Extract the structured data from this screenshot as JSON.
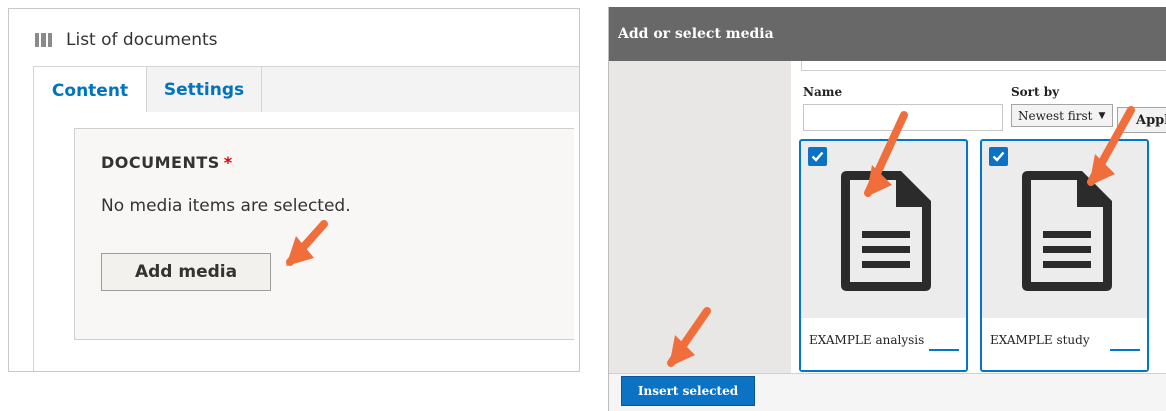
{
  "left_panel": {
    "title": "List of documents",
    "tabs": [
      {
        "label": "Content",
        "active": true
      },
      {
        "label": "Settings",
        "active": false
      }
    ],
    "field": {
      "label": "DOCUMENTS",
      "required_mark": "*",
      "empty_message": "No media items are selected.",
      "add_button": "Add media"
    }
  },
  "media_dialog": {
    "title": "Add or select media",
    "filters": {
      "name_label": "Name",
      "name_value": "",
      "sort_label": "Sort by",
      "sort_selected": "Newest first",
      "apply_label": "Appl"
    },
    "items": [
      {
        "name": "EXAMPLE analysis",
        "checked": true,
        "icon": "document-icon"
      },
      {
        "name": "EXAMPLE study",
        "checked": true,
        "icon": "document-icon"
      }
    ],
    "insert_button": "Insert selected"
  },
  "colors": {
    "accent": "#0b72c4",
    "tab_link": "#0074bd",
    "required": "#e00000",
    "dialog_header": "#686868",
    "annotation_arrow": "#f06e3c"
  }
}
